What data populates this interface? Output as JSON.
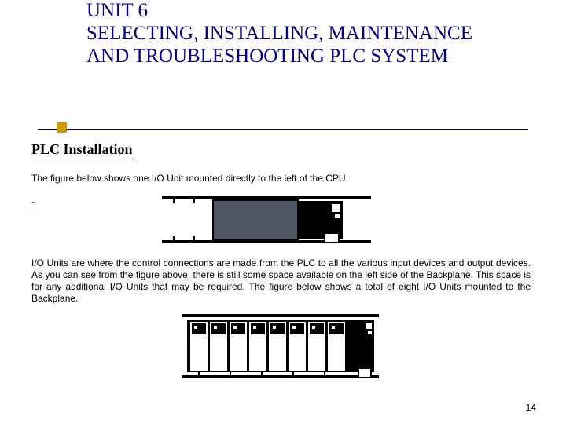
{
  "title": {
    "unit_line": "UNIT 6",
    "main": "SELECTING, INSTALLING, MAINTENANCE AND TROUBLESHOOTING PLC SYSTEM"
  },
  "section_heading": "PLC Installation",
  "intro_text": "The figure below shows one I/O Unit mounted directly to the left of the CPU.",
  "red_marker": "-",
  "mid_paragraph": "I/O Units are where the control connections are made from the PLC to all the various input devices and output devices. As you can see from the figure above, there is still some space available on the left side of the Backplane. This space is for any additional I/O Units that may be required. The figure below shows a total of eight I/O Units mounted to the Backplane.",
  "page_number": "14",
  "figure1": {
    "io_units": 1,
    "cpu_present": true
  },
  "figure2": {
    "io_units": 8,
    "cpu_present": true
  }
}
